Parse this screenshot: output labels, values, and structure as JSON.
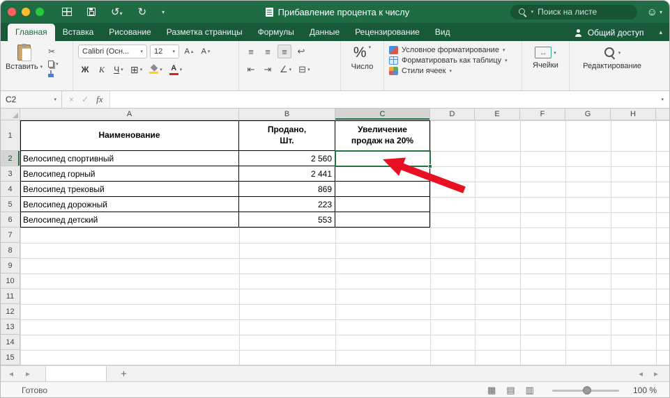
{
  "titlebar": {
    "title": "Прибавление процента к числу",
    "search_placeholder": "Поиск на листе"
  },
  "tabs": [
    {
      "label": "Главная"
    },
    {
      "label": "Вставка"
    },
    {
      "label": "Рисование"
    },
    {
      "label": "Разметка страницы"
    },
    {
      "label": "Формулы"
    },
    {
      "label": "Данные"
    },
    {
      "label": "Рецензирование"
    },
    {
      "label": "Вид"
    }
  ],
  "share": {
    "label": "Общий доступ"
  },
  "ribbon": {
    "paste_label": "Вставить",
    "font_name": "Calibri (Осн...",
    "font_size": "12",
    "bold_label": "Ж",
    "italic_label": "К",
    "underline_label": "Ч",
    "grow_font": "A",
    "shrink_font": "A",
    "font_color_letter": "А",
    "percent_label": "%",
    "number_label": "Число",
    "conditional_formatting_label": "Условное форматирование",
    "format_as_table_label": "Форматировать как таблицу",
    "cell_styles_label": "Стили ячеек",
    "cells_label": "Ячейки",
    "editing_label": "Редактирование"
  },
  "formula_bar": {
    "name_box": "C2",
    "cancel_label": "×",
    "enter_label": "✓",
    "fx_label": "fx"
  },
  "icons": {
    "caret_down": "▾",
    "caret_up": "▴",
    "scissors": "✂",
    "undo": "↺",
    "redo": "↻",
    "align_lines": "≡",
    "wrap_text": "↩",
    "indent_left": "⇤",
    "indent_right": "⇥",
    "merge": "⊟",
    "borders": "⊞",
    "angle": "∠",
    "smiley": "☺",
    "arrows_lr": "↔",
    "nav_left": "◂",
    "nav_right": "▸",
    "view_normal": "▦",
    "view_layout": "▤",
    "view_break": "▥"
  },
  "sheet": {
    "columns": [
      "A",
      "B",
      "C",
      "D",
      "E",
      "F",
      "G",
      "H"
    ],
    "rows": [
      "1",
      "2",
      "3",
      "4",
      "5",
      "6",
      "7",
      "8",
      "9",
      "10",
      "11",
      "12",
      "13",
      "14",
      "15"
    ],
    "table": {
      "header_name": "Наименование",
      "header_sold": "Продано,\nШт.",
      "header_increase": "Увеличение\nпродаж на 20%",
      "rows": [
        {
          "name": "Велосипед спортивный",
          "qty": "2 560"
        },
        {
          "name": "Велосипед горный",
          "qty": "2 441"
        },
        {
          "name": "Велосипед трековый",
          "qty": "869"
        },
        {
          "name": "Велосипед дорожный",
          "qty": "223"
        },
        {
          "name": "Велосипед детский",
          "qty": "553"
        }
      ]
    }
  },
  "sheet_tabs": {
    "active_label": "",
    "add_label": "+"
  },
  "status_bar": {
    "ready_label": "Готово",
    "zoom_label": "100 %"
  }
}
